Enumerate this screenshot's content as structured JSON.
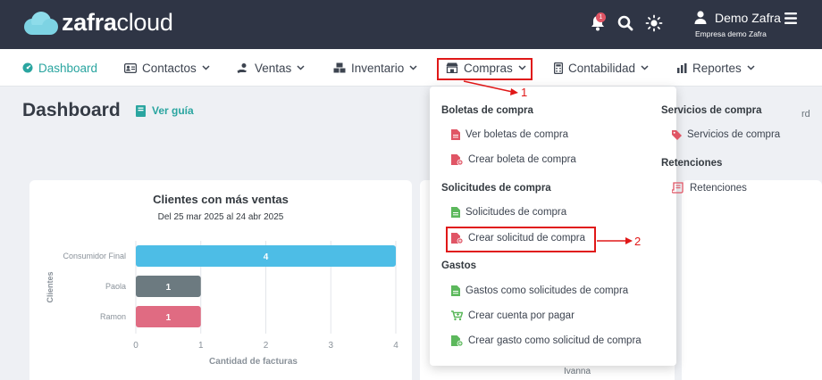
{
  "brand": {
    "name_bold": "zafra",
    "name_light": "cloud"
  },
  "header": {
    "notification_count": "1",
    "user_name": "Demo Zafra",
    "company": "Empresa demo Zafra"
  },
  "nav": {
    "items": [
      {
        "label": "Dashboard",
        "icon": "dashboard-icon"
      },
      {
        "label": "Contactos",
        "icon": "contacts-card-icon"
      },
      {
        "label": "Ventas",
        "icon": "sales-hand-icon"
      },
      {
        "label": "Inventario",
        "icon": "inventory-boxes-icon"
      },
      {
        "label": "Compras",
        "icon": "store-icon"
      },
      {
        "label": "Contabilidad",
        "icon": "calculator-icon"
      },
      {
        "label": "Reportes",
        "icon": "bar-chart-icon"
      }
    ]
  },
  "page": {
    "title": "Dashboard",
    "guide_label": "Ver guía",
    "right_hint": "rd"
  },
  "card_left": {
    "title": "Clientes con más ventas",
    "subtitle": "Del 25 mar 2025 al 24 abr 2025"
  },
  "card_right_partial": {
    "visible_label": "Ivanna"
  },
  "chart_data": {
    "type": "bar",
    "orientation": "horizontal",
    "title": "Clientes con más ventas",
    "subtitle": "Del 25 mar 2025 al 24 abr 2025",
    "categories": [
      "Consumidor Final",
      "Paola",
      "Ramon"
    ],
    "values": [
      4,
      1,
      1
    ],
    "colors": [
      "#4dbde6",
      "#6c7a80",
      "#e06b82"
    ],
    "xlabel": "Cantidad de facturas",
    "ylabel": "Clientes",
    "xlim": [
      0,
      4
    ],
    "xticks": [
      "0",
      "1",
      "2",
      "3",
      "4"
    ],
    "grid": true
  },
  "dropdown": {
    "boletas_header": "Boletas de compra",
    "ver_boletas": "Ver boletas de compra",
    "crear_boleta": "Crear boleta de compra",
    "solicitudes_header": "Solicitudes de compra",
    "solicitudes": "Solicitudes de compra",
    "crear_solicitud": "Crear solicitud de compra",
    "gastos_header": "Gastos",
    "gastos_solicitudes": "Gastos como solicitudes de compra",
    "crear_cuenta": "Crear cuenta por pagar",
    "crear_gasto": "Crear gasto como solicitud de compra",
    "servicios_header": "Servicios de compra",
    "servicios": "Servicios de compra",
    "retenciones_header": "Retenciones",
    "retenciones": "Retenciones"
  },
  "annotations": {
    "step1": "1",
    "step2": "2"
  },
  "colors": {
    "accent": "#2aa5a0",
    "header_bg": "#2f3545",
    "highlight": "#e01818",
    "icon_red": "#e05565",
    "icon_green": "#5cb85c"
  }
}
